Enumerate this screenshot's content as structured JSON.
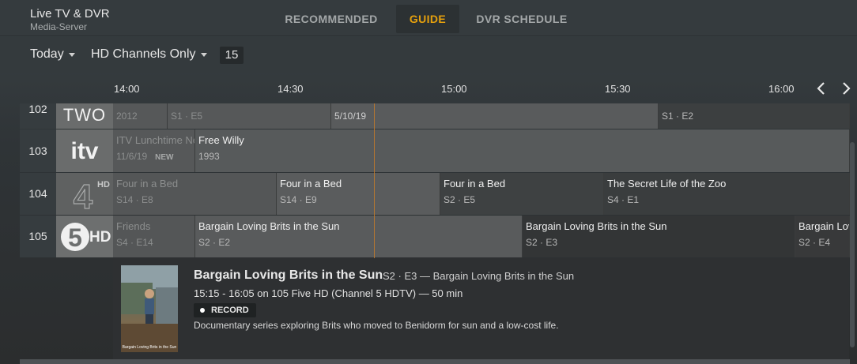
{
  "app": {
    "title": "Live TV & DVR",
    "server": "Media-Server"
  },
  "tabs": [
    {
      "label": "RECOMMENDED",
      "active": false
    },
    {
      "label": "GUIDE",
      "active": true
    },
    {
      "label": "DVR SCHEDULE",
      "active": false
    }
  ],
  "filters": {
    "day": "Today",
    "channel_filter": "HD Channels Only",
    "count": "15"
  },
  "timeline": [
    "14:00",
    "14:30",
    "15:00",
    "15:30",
    "16:00"
  ],
  "icons": {
    "prev": "chevron-left-icon",
    "next": "chevron-right-icon",
    "record": "record-dot-icon",
    "caret": "caret-down-icon"
  },
  "colors": {
    "accent": "#e5a00d",
    "now_line": "#c47b2a"
  },
  "channels": [
    {
      "number": "102",
      "logo": "TWO",
      "programs": [
        {
          "title": "",
          "sub": "2012"
        },
        {
          "title": "",
          "sub": "S1 · E5"
        },
        {
          "title": "",
          "sub": "5/10/19"
        },
        {
          "title": "",
          "sub": "S1 · E2"
        }
      ]
    },
    {
      "number": "103",
      "logo": "itv",
      "programs": [
        {
          "title": "ITV Lunchtime Ne",
          "sub": "11/6/19",
          "tag": "NEW"
        },
        {
          "title": "Free Willy",
          "sub": "1993"
        }
      ]
    },
    {
      "number": "104",
      "logo": "4HD",
      "programs": [
        {
          "title": "Four in a Bed",
          "sub": "S14 · E8"
        },
        {
          "title": "Four in a Bed",
          "sub": "S14 · E9"
        },
        {
          "title": "Four in a Bed",
          "sub": "S2 · E5"
        },
        {
          "title": "The Secret Life of the Zoo",
          "sub": "S4 · E1"
        }
      ]
    },
    {
      "number": "105",
      "logo": "5HD",
      "programs": [
        {
          "title": "Friends",
          "sub": "S4 · E14"
        },
        {
          "title": "Bargain Loving Brits in the Sun",
          "sub": "S2 · E2"
        },
        {
          "title": "Bargain Loving Brits in the Sun",
          "sub": "S2 · E3"
        },
        {
          "title": "Bargain Lov",
          "sub": "S2 · E4"
        }
      ]
    }
  ],
  "details": {
    "title": "Bargain Loving Brits in the Sun",
    "meta": "S2 · E3 — Bargain Loving Brits in the Sun",
    "time": "15:15 - 16:05 on 105 Five HD (Channel 5 HDTV) — 50 min",
    "record_label": "RECORD",
    "description": "Documentary series exploring Brits who moved to Benidorm for sun and a low-cost life.",
    "poster_caption": "Bargain Loving Brits in the Sun"
  }
}
